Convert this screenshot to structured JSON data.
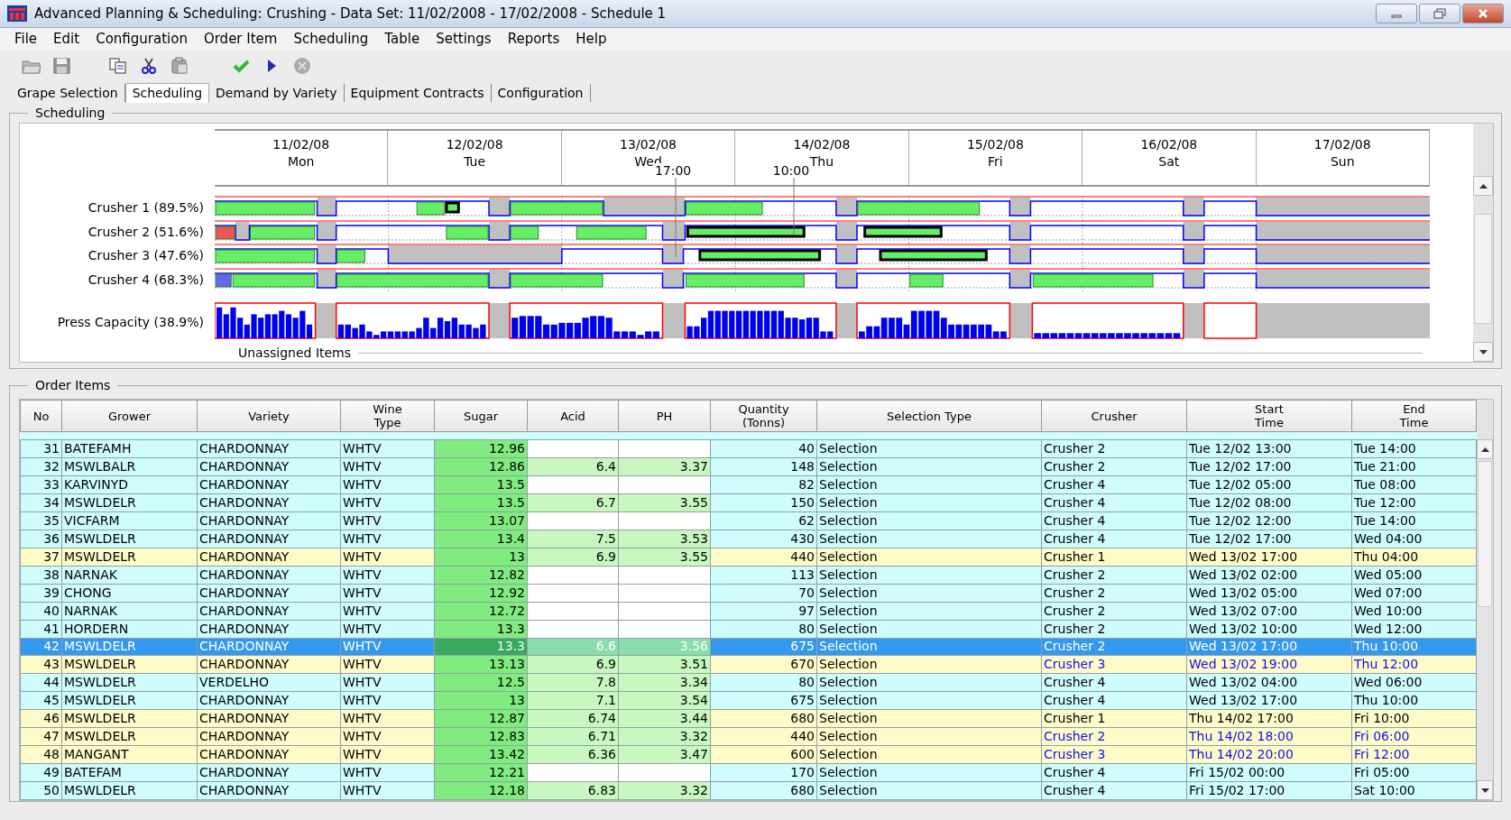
{
  "window": {
    "title": "Advanced Planning & Scheduling: Crushing - Data Set: 11/02/2008 - 17/02/2008 - Schedule 1"
  },
  "menu": [
    "File",
    "Edit",
    "Configuration",
    "Order Item",
    "Scheduling",
    "Table",
    "Settings",
    "Reports",
    "Help"
  ],
  "tabs": [
    {
      "label": "Grape Selection",
      "selected": false
    },
    {
      "label": "Scheduling",
      "selected": true
    },
    {
      "label": "Demand by Variety",
      "selected": false
    },
    {
      "label": "Equipment Contracts",
      "selected": false
    },
    {
      "label": "Configuration",
      "selected": false
    }
  ],
  "scheduling": {
    "title": "Scheduling",
    "days": [
      {
        "date": "11/02/08",
        "day": "Mon"
      },
      {
        "date": "12/02/08",
        "day": "Tue"
      },
      {
        "date": "13/02/08",
        "day": "Wed"
      },
      {
        "date": "14/02/08",
        "day": "Thu"
      },
      {
        "date": "15/02/08",
        "day": "Fri"
      },
      {
        "date": "16/02/08",
        "day": "Sat"
      },
      {
        "date": "17/02/08",
        "day": "Sun"
      }
    ],
    "markers": [
      "17:00",
      "10:00"
    ],
    "resources": [
      {
        "label": "Crusher 1 (89.5%)",
        "kind": "crusher"
      },
      {
        "label": "Crusher 2 (51.6%)",
        "kind": "crusher"
      },
      {
        "label": "Crusher 3 (47.6%)",
        "kind": "crusher"
      },
      {
        "label": "Crusher 4 (68.3%)",
        "kind": "crusher"
      },
      {
        "label": "Press Capacity (38.9%)",
        "kind": "press"
      }
    ],
    "unassigned": "Unassigned Items"
  },
  "order_items": {
    "title": "Order Items",
    "columns": [
      "No",
      "Grower",
      "Variety",
      "Wine\nType",
      "Sugar",
      "Acid",
      "PH",
      "Quantity\n(Tonns)",
      "Selection Type",
      "Crusher",
      "Start\nTime",
      "End\nTime"
    ],
    "rows": [
      {
        "no": "31",
        "grower": "BATEFAMH",
        "variety": "CHARDONNAY",
        "wine_type": "WHTV",
        "sugar": "12.96",
        "acid": "",
        "ph": "",
        "quantity": "40",
        "selection_type": "Selection",
        "crusher": "Crusher 2",
        "start": "Tue 12/02 13:00",
        "end": "Tue 14:00",
        "highlighted": false,
        "selected": false,
        "moved": false
      },
      {
        "no": "32",
        "grower": "MSWLBALR",
        "variety": "CHARDONNAY",
        "wine_type": "WHTV",
        "sugar": "12.86",
        "acid": "6.4",
        "ph": "3.37",
        "quantity": "148",
        "selection_type": "Selection",
        "crusher": "Crusher 2",
        "start": "Tue 12/02 17:00",
        "end": "Tue 21:00",
        "highlighted": false,
        "selected": false,
        "moved": false
      },
      {
        "no": "33",
        "grower": "KARVINYD",
        "variety": "CHARDONNAY",
        "wine_type": "WHTV",
        "sugar": "13.5",
        "acid": "",
        "ph": "",
        "quantity": "82",
        "selection_type": "Selection",
        "crusher": "Crusher 4",
        "start": "Tue 12/02 05:00",
        "end": "Tue 08:00",
        "highlighted": false,
        "selected": false,
        "moved": false
      },
      {
        "no": "34",
        "grower": "MSWLDELR",
        "variety": "CHARDONNAY",
        "wine_type": "WHTV",
        "sugar": "13.5",
        "acid": "6.7",
        "ph": "3.55",
        "quantity": "150",
        "selection_type": "Selection",
        "crusher": "Crusher 4",
        "start": "Tue 12/02 08:00",
        "end": "Tue 12:00",
        "highlighted": false,
        "selected": false,
        "moved": false
      },
      {
        "no": "35",
        "grower": "VICFARM",
        "variety": "CHARDONNAY",
        "wine_type": "WHTV",
        "sugar": "13.07",
        "acid": "",
        "ph": "",
        "quantity": "62",
        "selection_type": "Selection",
        "crusher": "Crusher 4",
        "start": "Tue 12/02 12:00",
        "end": "Tue 14:00",
        "highlighted": false,
        "selected": false,
        "moved": false
      },
      {
        "no": "36",
        "grower": "MSWLDELR",
        "variety": "CHARDONNAY",
        "wine_type": "WHTV",
        "sugar": "13.4",
        "acid": "7.5",
        "ph": "3.53",
        "quantity": "430",
        "selection_type": "Selection",
        "crusher": "Crusher 4",
        "start": "Tue 12/02 17:00",
        "end": "Wed 04:00",
        "highlighted": false,
        "selected": false,
        "moved": false
      },
      {
        "no": "37",
        "grower": "MSWLDELR",
        "variety": "CHARDONNAY",
        "wine_type": "WHTV",
        "sugar": "13",
        "acid": "6.9",
        "ph": "3.55",
        "quantity": "440",
        "selection_type": "Selection",
        "crusher": "Crusher 1",
        "start": "Wed 13/02 17:00",
        "end": "Thu 04:00",
        "highlighted": true,
        "selected": false,
        "moved": false
      },
      {
        "no": "38",
        "grower": "NARNAK",
        "variety": "CHARDONNAY",
        "wine_type": "WHTV",
        "sugar": "12.82",
        "acid": "",
        "ph": "",
        "quantity": "113",
        "selection_type": "Selection",
        "crusher": "Crusher 2",
        "start": "Wed 13/02 02:00",
        "end": "Wed 05:00",
        "highlighted": false,
        "selected": false,
        "moved": false
      },
      {
        "no": "39",
        "grower": "CHONG",
        "variety": "CHARDONNAY",
        "wine_type": "WHTV",
        "sugar": "12.92",
        "acid": "",
        "ph": "",
        "quantity": "70",
        "selection_type": "Selection",
        "crusher": "Crusher 2",
        "start": "Wed 13/02 05:00",
        "end": "Wed 07:00",
        "highlighted": false,
        "selected": false,
        "moved": false
      },
      {
        "no": "40",
        "grower": "NARNAK",
        "variety": "CHARDONNAY",
        "wine_type": "WHTV",
        "sugar": "12.72",
        "acid": "",
        "ph": "",
        "quantity": "97",
        "selection_type": "Selection",
        "crusher": "Crusher 2",
        "start": "Wed 13/02 07:00",
        "end": "Wed 10:00",
        "highlighted": false,
        "selected": false,
        "moved": false
      },
      {
        "no": "41",
        "grower": "HORDERN",
        "variety": "CHARDONNAY",
        "wine_type": "WHTV",
        "sugar": "13.3",
        "acid": "",
        "ph": "",
        "quantity": "80",
        "selection_type": "Selection",
        "crusher": "Crusher 2",
        "start": "Wed 13/02 10:00",
        "end": "Wed 12:00",
        "highlighted": false,
        "selected": false,
        "moved": false
      },
      {
        "no": "42",
        "grower": "MSWLDELR",
        "variety": "CHARDONNAY",
        "wine_type": "WHTV",
        "sugar": "13.3",
        "acid": "6.6",
        "ph": "3.56",
        "quantity": "675",
        "selection_type": "Selection",
        "crusher": "Crusher 2",
        "start": "Wed 13/02 17:00",
        "end": "Thu 10:00",
        "highlighted": false,
        "selected": true,
        "moved": false
      },
      {
        "no": "43",
        "grower": "MSWLDELR",
        "variety": "CHARDONNAY",
        "wine_type": "WHTV",
        "sugar": "13.13",
        "acid": "6.9",
        "ph": "3.51",
        "quantity": "670",
        "selection_type": "Selection",
        "crusher": "Crusher 3",
        "start": "Wed 13/02 19:00",
        "end": "Thu 12:00",
        "highlighted": true,
        "selected": false,
        "moved": true
      },
      {
        "no": "44",
        "grower": "MSWLDELR",
        "variety": "VERDELHO",
        "wine_type": "WHTV",
        "sugar": "12.5",
        "acid": "7.8",
        "ph": "3.34",
        "quantity": "80",
        "selection_type": "Selection",
        "crusher": "Crusher 4",
        "start": "Wed 13/02 04:00",
        "end": "Wed 06:00",
        "highlighted": false,
        "selected": false,
        "moved": false
      },
      {
        "no": "45",
        "grower": "MSWLDELR",
        "variety": "CHARDONNAY",
        "wine_type": "WHTV",
        "sugar": "13",
        "acid": "7.1",
        "ph": "3.54",
        "quantity": "675",
        "selection_type": "Selection",
        "crusher": "Crusher 4",
        "start": "Wed 13/02 17:00",
        "end": "Thu 10:00",
        "highlighted": false,
        "selected": false,
        "moved": false
      },
      {
        "no": "46",
        "grower": "MSWLDELR",
        "variety": "CHARDONNAY",
        "wine_type": "WHTV",
        "sugar": "12.87",
        "acid": "6.74",
        "ph": "3.44",
        "quantity": "680",
        "selection_type": "Selection",
        "crusher": "Crusher 1",
        "start": "Thu 14/02 17:00",
        "end": "Fri 10:00",
        "highlighted": true,
        "selected": false,
        "moved": false
      },
      {
        "no": "47",
        "grower": "MSWLDELR",
        "variety": "CHARDONNAY",
        "wine_type": "WHTV",
        "sugar": "12.83",
        "acid": "6.71",
        "ph": "3.32",
        "quantity": "440",
        "selection_type": "Selection",
        "crusher": "Crusher 2",
        "start": "Thu 14/02 18:00",
        "end": "Fri 06:00",
        "highlighted": true,
        "selected": false,
        "moved": true
      },
      {
        "no": "48",
        "grower": "MANGANT",
        "variety": "CHARDONNAY",
        "wine_type": "WHTV",
        "sugar": "13.42",
        "acid": "6.36",
        "ph": "3.47",
        "quantity": "600",
        "selection_type": "Selection",
        "crusher": "Crusher 3",
        "start": "Thu 14/02 20:00",
        "end": "Fri 12:00",
        "highlighted": true,
        "selected": false,
        "moved": true
      },
      {
        "no": "49",
        "grower": "BATEFAM",
        "variety": "CHARDONNAY",
        "wine_type": "WHTV",
        "sugar": "12.21",
        "acid": "",
        "ph": "",
        "quantity": "170",
        "selection_type": "Selection",
        "crusher": "Crusher 4",
        "start": "Fri 15/02 00:00",
        "end": "Fri 05:00",
        "highlighted": false,
        "selected": false,
        "moved": false
      },
      {
        "no": "50",
        "grower": "MSWLDELR",
        "variety": "CHARDONNAY",
        "wine_type": "WHTV",
        "sugar": "12.18",
        "acid": "6.83",
        "ph": "3.32",
        "quantity": "680",
        "selection_type": "Selection",
        "crusher": "Crusher 4",
        "start": "Fri 15/02 17:00",
        "end": "Sat 10:00",
        "highlighted": false,
        "selected": false,
        "moved": false
      }
    ]
  }
}
